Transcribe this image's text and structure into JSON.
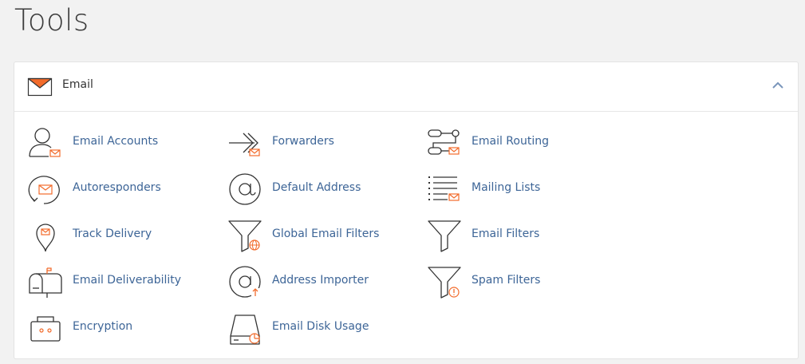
{
  "page": {
    "title": "Tools"
  },
  "section": {
    "title": "Email",
    "colors": {
      "accent": "#f26b2b",
      "link": "#3d6597",
      "highlight": "#e8121a"
    }
  },
  "tools": [
    {
      "label": "Email Accounts",
      "icon": "user-mail-icon"
    },
    {
      "label": "Forwarders",
      "icon": "forward-mail-icon"
    },
    {
      "label": "Email Routing",
      "icon": "routing-mail-icon"
    },
    {
      "label": "Autoresponders",
      "icon": "autoresponder-icon"
    },
    {
      "label": "Default Address",
      "icon": "at-sign-icon"
    },
    {
      "label": "Mailing Lists",
      "icon": "list-mail-icon"
    },
    {
      "label": "Track Delivery",
      "icon": "location-pin-mail-icon"
    },
    {
      "label": "Global Email Filters",
      "icon": "funnel-globe-icon"
    },
    {
      "label": "Email Filters",
      "icon": "funnel-icon"
    },
    {
      "label": "Email Deliverability",
      "icon": "mailbox-icon"
    },
    {
      "label": "Address Importer",
      "icon": "at-import-icon"
    },
    {
      "label": "Spam Filters",
      "icon": "funnel-alert-icon"
    },
    {
      "label": "Encryption",
      "icon": "encryption-box-icon"
    },
    {
      "label": "Email Disk Usage",
      "icon": "disk-usage-icon"
    }
  ]
}
